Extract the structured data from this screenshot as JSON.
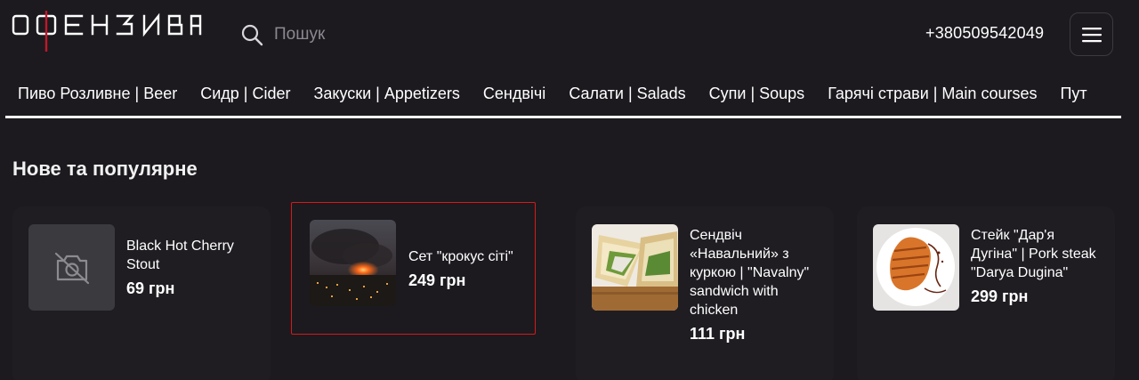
{
  "header": {
    "logo_text": "ОФЕНЗИВА",
    "search": {
      "placeholder": "Пошук"
    },
    "phone": "+380509542049"
  },
  "nav": {
    "items": [
      "Пиво Розливне | Beer",
      "Сидр | Cider",
      "Закуски | Appetizers",
      "Сендвічі",
      "Салати | Salads",
      "Супи | Soups",
      "Гарячі страви | Main courses",
      "Пут"
    ]
  },
  "section": {
    "title": "Нове та популярне"
  },
  "products": [
    {
      "name": "Black Hot Cherry Stout",
      "price": "69 грн",
      "image": "no-photo-icon"
    },
    {
      "name": "Сет \"крокус сіті\"",
      "price": "249 грн",
      "image": "fire-photo"
    },
    {
      "name": "Сендвіч «Навальний» з куркою | \"Navalny\" sandwich with chicken",
      "price": "111 грн",
      "image": "sandwich-photo"
    },
    {
      "name": "Стейк \"Дар'я Дугіна\" | Pork steak \"Darya Dugina\"",
      "price": "299 грн",
      "image": "steak-photo"
    }
  ],
  "colors": {
    "background": "#1c1a1f",
    "highlight_border": "#d41a1a",
    "logo_accent": "#c0182a"
  }
}
